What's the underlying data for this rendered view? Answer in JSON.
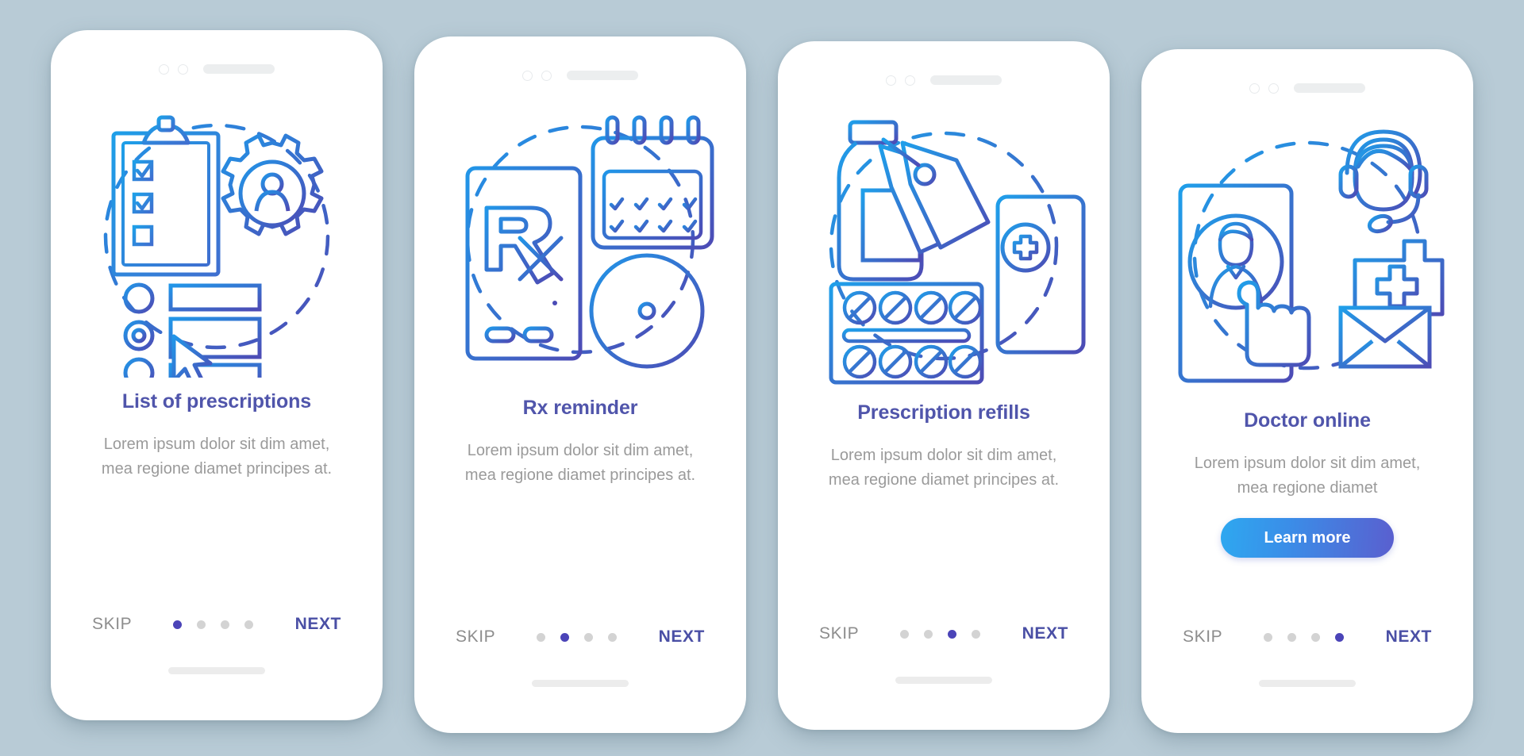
{
  "background_color": "#b8cbd6",
  "accent_title_color": "#5055ab",
  "body_text_color": "#9a9a9a",
  "active_dot_color": "#4b44b8",
  "inactive_dot_color": "#d3d3d3",
  "screens": [
    {
      "id": "list-of-prescriptions",
      "illustration": "clipboard-checklist-gear-user-cursor-icon",
      "title": "List of prescriptions",
      "body": "Lorem ipsum dolor sit dim amet, mea regione diamet principes at.",
      "skip_label": "SKIP",
      "next_label": "NEXT",
      "active_dot": 0,
      "dot_count": 4,
      "has_cta": false,
      "cta_label": ""
    },
    {
      "id": "rx-reminder",
      "illustration": "phone-rx-calendar-clock-icon",
      "title": "Rx reminder",
      "body": "Lorem ipsum dolor sit dim amet, mea regione diamet principes at.",
      "skip_label": "SKIP",
      "next_label": "NEXT",
      "active_dot": 1,
      "dot_count": 4,
      "has_cta": false,
      "cta_label": ""
    },
    {
      "id": "prescription-refills",
      "illustration": "medicine-bottle-tag-pills-phone-icon",
      "title": "Prescription refills",
      "body": "Lorem ipsum dolor sit dim amet, mea regione diamet principes at.",
      "skip_label": "SKIP",
      "next_label": "NEXT",
      "active_dot": 2,
      "dot_count": 4,
      "has_cta": false,
      "cta_label": ""
    },
    {
      "id": "doctor-online",
      "illustration": "phone-doctor-operator-headset-mail-icon",
      "title": "Doctor online",
      "body": "Lorem ipsum dolor sit dim amet, mea regione diamet",
      "skip_label": "SKIP",
      "next_label": "NEXT",
      "active_dot": 3,
      "dot_count": 4,
      "has_cta": true,
      "cta_label": "Learn more"
    }
  ]
}
